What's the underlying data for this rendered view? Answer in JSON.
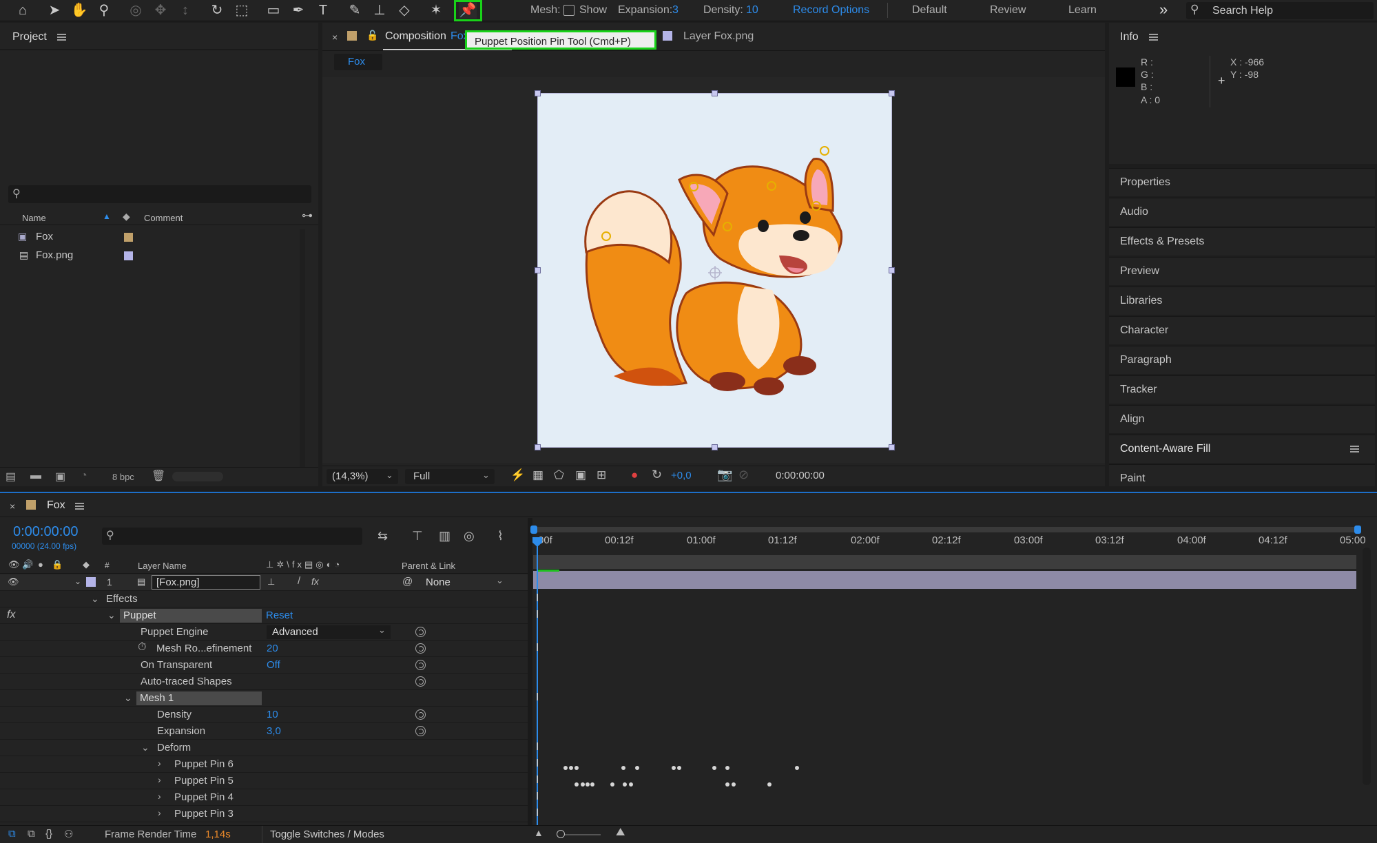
{
  "toolbar": {
    "mesh_label": "Mesh:",
    "show_label": "Show",
    "expansion_label": "Expansion:",
    "expansion_value": "3",
    "density_label": "Density:",
    "density_value": "10",
    "record_options": "Record Options",
    "workspaces": [
      "Default",
      "Review",
      "Learn"
    ],
    "more": "»",
    "search_help": "Search Help"
  },
  "project": {
    "title": "Project",
    "columns": {
      "name": "Name",
      "comment": "Comment"
    },
    "items": [
      {
        "name": "Fox",
        "swatch": "#c0a06a"
      },
      {
        "name": "Fox.png",
        "swatch": "#b4b4e8"
      }
    ],
    "bpc": "8 bpc"
  },
  "composition": {
    "tab_label": "Composition",
    "tab_comp_name": "Fox",
    "tooltip": "Puppet Position Pin Tool (Cmd+P)",
    "layer_tab": "Layer Fox.png",
    "breadcrumb": "Fox",
    "zoom": "(14,3%)",
    "resolution": "Full",
    "exposure": "+0,0",
    "timecode": "0:00:00:00"
  },
  "info": {
    "title": "Info",
    "r": "R :",
    "g": "G :",
    "b": "B :",
    "a": "A : 0",
    "x": "X : -966",
    "y": "Y : -98"
  },
  "right_panels": [
    "Properties",
    "Audio",
    "Effects & Presets",
    "Preview",
    "Libraries",
    "Character",
    "Paragraph",
    "Tracker",
    "Align",
    "Content-Aware Fill",
    "Paint"
  ],
  "timeline": {
    "comp_name": "Fox",
    "timecode": "0:00:00:00",
    "frames": "00000 (24.00 fps)",
    "col_hash": "#",
    "col_layer_name": "Layer Name",
    "col_parent": "Parent & Link",
    "ruler": [
      "00f",
      "00:12f",
      "01:00f",
      "01:12f",
      "02:00f",
      "02:12f",
      "03:00f",
      "03:12f",
      "04:00f",
      "04:12f",
      "05:00"
    ],
    "layer": {
      "index": "1",
      "name": "[Fox.png]",
      "parent": "None"
    },
    "effects_label": "Effects",
    "puppet_label": "Puppet",
    "reset": "Reset",
    "props": [
      {
        "name": "Puppet Engine",
        "value": "Advanced"
      },
      {
        "name": "Mesh Ro...efinement",
        "value": "20"
      },
      {
        "name": "On Transparent",
        "value": "Off"
      },
      {
        "name": "Auto-traced Shapes",
        "value": ""
      }
    ],
    "mesh_label": "Mesh 1",
    "mesh_props": [
      {
        "name": "Density",
        "value": "10"
      },
      {
        "name": "Expansion",
        "value": "3,0"
      }
    ],
    "deform_label": "Deform",
    "pins": [
      "Puppet Pin 6",
      "Puppet Pin 5",
      "Puppet Pin 4",
      "Puppet Pin 3"
    ]
  },
  "status": {
    "frame_render_label": "Frame Render Time",
    "frame_render_value": "1,14s",
    "toggle": "Toggle Switches / Modes"
  }
}
